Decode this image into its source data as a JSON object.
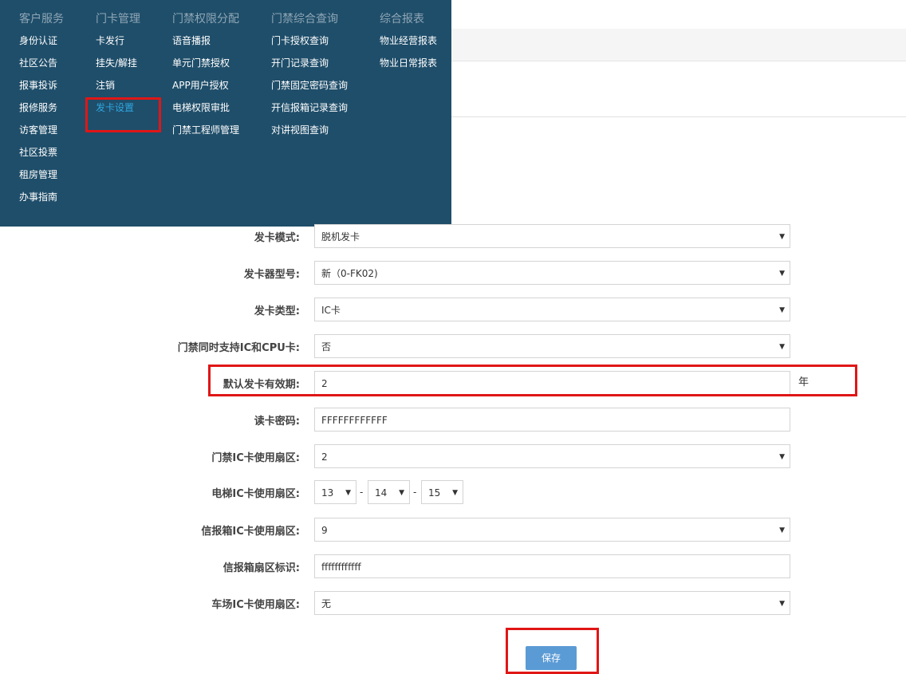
{
  "menu": {
    "columns": [
      {
        "header": "客户服务",
        "items": [
          "身份认证",
          "社区公告",
          "报事投诉",
          "报修服务",
          "访客管理",
          "社区投票",
          "租房管理",
          "办事指南"
        ]
      },
      {
        "header": "门卡管理",
        "items": [
          "卡发行",
          "挂失/解挂",
          "注销",
          "发卡设置"
        ]
      },
      {
        "header": "门禁权限分配",
        "items": [
          "语音播报",
          "单元门禁授权",
          "APP用户授权",
          "电梯权限审批",
          "门禁工程师管理"
        ]
      },
      {
        "header": "门禁综合查询",
        "items": [
          "门卡授权查询",
          "开门记录查询",
          "门禁固定密码查询",
          "开信报箱记录查询",
          "对讲视图查询"
        ]
      },
      {
        "header": "综合报表",
        "items": [
          "物业经营报表",
          "物业日常报表"
        ]
      }
    ],
    "active_item": "发卡设置"
  },
  "form": {
    "issue_mode": {
      "label": "发卡模式:",
      "value": "脱机发卡"
    },
    "reader_model": {
      "label": "发卡器型号:",
      "value": "新（0-FK02)"
    },
    "card_type": {
      "label": "发卡类型:",
      "value": "IC卡"
    },
    "ic_cpu_support": {
      "label": "门禁同时支持IC和CPU卡:",
      "value": "否"
    },
    "default_validity": {
      "label": "默认发卡有效期:",
      "value": "2",
      "unit": "年"
    },
    "read_password": {
      "label": "读卡密码:",
      "value": "FFFFFFFFFFFF"
    },
    "door_sector": {
      "label": "门禁IC卡使用扇区:",
      "value": "2"
    },
    "elevator_sector": {
      "label": "电梯IC卡使用扇区:",
      "values": [
        "13",
        "14",
        "15"
      ],
      "separator": "-"
    },
    "mailbox_sector": {
      "label": "信报箱IC卡使用扇区:",
      "value": "9"
    },
    "mailbox_sector_id": {
      "label": "信报箱扇区标识:",
      "value": "ffffffffffff"
    },
    "parking_sector": {
      "label": "车场IC卡使用扇区:",
      "value": "无"
    }
  },
  "save_label": "保存",
  "icons": {
    "dropdown": "chevron-down-icon"
  },
  "colors": {
    "menu_bg": "#1f4e6a",
    "active": "#2ea7e0",
    "save_button": "#5b9bd5",
    "highlight": "#e01616"
  }
}
